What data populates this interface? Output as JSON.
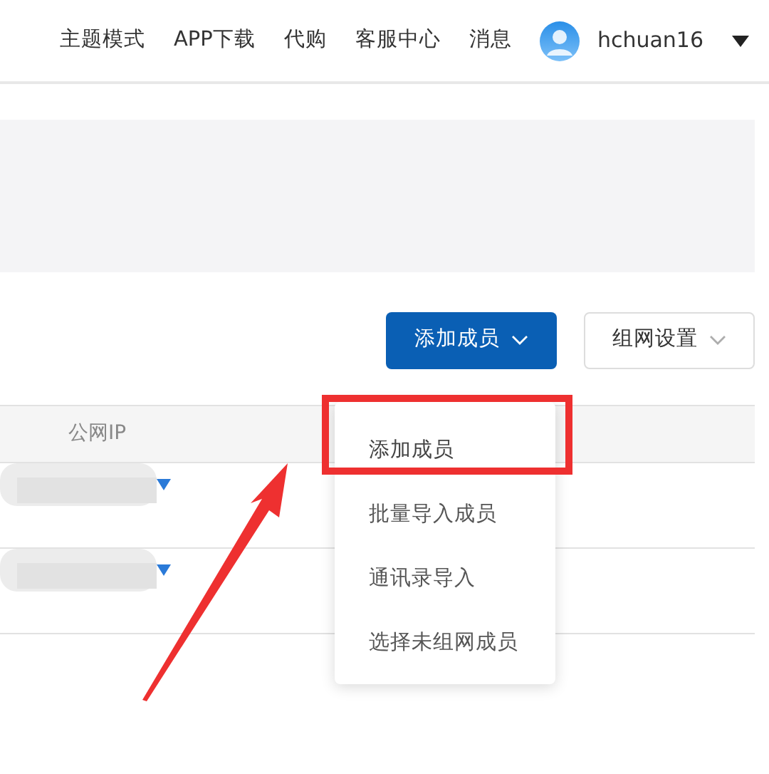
{
  "header": {
    "nav": [
      "主题模式",
      "APP下载",
      "代购",
      "客服中心",
      "消息"
    ],
    "user": "hchuan16"
  },
  "actions": [
    {
      "label": "添加成员",
      "kind": "primary",
      "expanded": true
    },
    {
      "label": "组网设置",
      "kind": "outline",
      "expanded": false
    }
  ],
  "table": {
    "columns": [
      "公网IP"
    ],
    "rows": [
      {
        "redacted": true
      },
      {
        "redacted": true
      }
    ]
  },
  "dropdown": [
    {
      "label": "添加成员",
      "highlighted": true
    },
    {
      "label": "批量导入成员",
      "highlighted": false
    },
    {
      "label": "通讯录导入",
      "highlighted": false
    },
    {
      "label": "选择未组网成员",
      "highlighted": false
    }
  ]
}
